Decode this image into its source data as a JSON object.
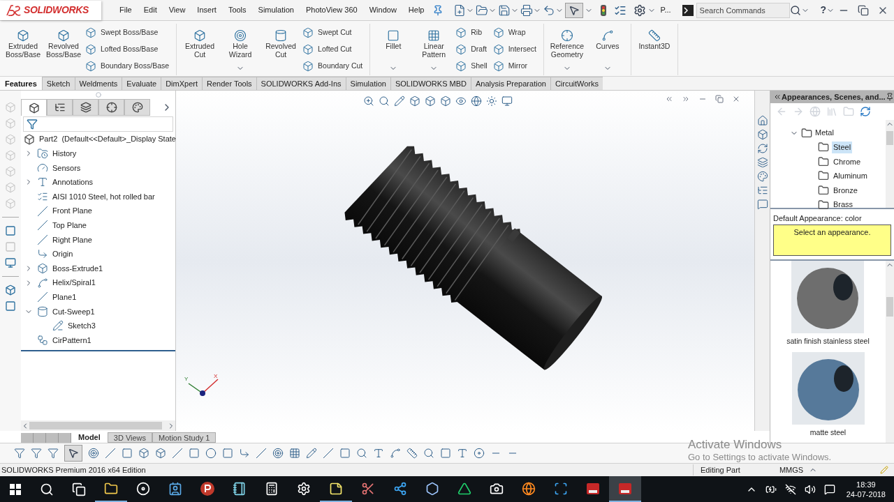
{
  "title_bar": {
    "logo": "SOLIDWORKS",
    "menu": [
      "File",
      "Edit",
      "View",
      "Insert",
      "Tools",
      "Simulation",
      "PhotoView 360",
      "Window",
      "Help"
    ],
    "truncated_command": "P...",
    "search": {
      "placeholder": "Search Commands"
    },
    "help": "?"
  },
  "ribbon": {
    "groups": [
      {
        "columns": [
          {
            "kind": "large",
            "label": "Extruded Boss/Base",
            "dropdown": false
          },
          {
            "kind": "large",
            "label": "Revolved Boss/Base",
            "dropdown": false
          },
          {
            "kind": "stack",
            "items": [
              "Swept Boss/Base",
              "Lofted Boss/Base",
              "Boundary Boss/Base"
            ]
          }
        ]
      },
      {
        "columns": [
          {
            "kind": "large",
            "label": "Extruded Cut",
            "dropdown": false
          },
          {
            "kind": "large",
            "label": "Hole Wizard",
            "dropdown": true
          },
          {
            "kind": "large",
            "label": "Revolved Cut",
            "dropdown": false
          },
          {
            "kind": "stack",
            "items": [
              "Swept Cut",
              "Lofted Cut",
              "Boundary Cut"
            ]
          }
        ]
      },
      {
        "columns": [
          {
            "kind": "large",
            "label": "Fillet",
            "dropdown": true
          },
          {
            "kind": "large",
            "label": "Linear Pattern",
            "dropdown": true
          },
          {
            "kind": "stack",
            "items": [
              "Rib",
              "Draft",
              "Shell"
            ]
          },
          {
            "kind": "stack",
            "items": [
              "Wrap",
              "Intersect",
              "Mirror"
            ]
          }
        ]
      },
      {
        "columns": [
          {
            "kind": "large",
            "label": "Reference Geometry",
            "dropdown": true
          },
          {
            "kind": "large",
            "label": "Curves",
            "dropdown": true
          }
        ]
      },
      {
        "columns": [
          {
            "kind": "large",
            "label": "Instant3D",
            "dropdown": false
          }
        ]
      }
    ]
  },
  "command_tabs": [
    {
      "label": "Features",
      "selected": true
    },
    {
      "label": "Sketch",
      "selected": false
    },
    {
      "label": "Weldments",
      "selected": false
    },
    {
      "label": "Evaluate",
      "selected": false
    },
    {
      "label": "DimXpert",
      "selected": false
    },
    {
      "label": "Render Tools",
      "selected": false
    },
    {
      "label": "SOLIDWORKS Add-Ins",
      "selected": false
    },
    {
      "label": "Simulation",
      "selected": false
    },
    {
      "label": "SOLIDWORKS MBD",
      "selected": false
    },
    {
      "label": "Analysis Preparation",
      "selected": false
    },
    {
      "label": "CircuitWorks",
      "selected": false
    }
  ],
  "feature_manager": {
    "panel_tabs": [
      {
        "selected": true
      },
      {
        "selected": false
      },
      {
        "selected": false
      },
      {
        "selected": false
      },
      {
        "selected": false
      }
    ],
    "root": "Part2  (Default<<Default>_Display State",
    "items": [
      {
        "label": "History",
        "kind": "history",
        "has_children": true,
        "expanded": false
      },
      {
        "label": "Sensors",
        "kind": "sensor",
        "has_children": false
      },
      {
        "label": "Annotations",
        "kind": "annotation",
        "has_children": true,
        "expanded": false
      },
      {
        "label": "AISI 1010 Steel, hot rolled bar",
        "kind": "material",
        "has_children": false
      },
      {
        "label": "Front Plane",
        "kind": "plane",
        "has_children": false
      },
      {
        "label": "Top Plane",
        "kind": "plane",
        "has_children": false
      },
      {
        "label": "Right Plane",
        "kind": "plane",
        "has_children": false
      },
      {
        "label": "Origin",
        "kind": "origin",
        "has_children": false
      },
      {
        "label": "Boss-Extrude1",
        "kind": "extrude",
        "has_children": true,
        "expanded": false
      },
      {
        "label": "Helix/Spiral1",
        "kind": "helix",
        "has_children": true,
        "expanded": false
      },
      {
        "label": "Plane1",
        "kind": "plane",
        "has_children": false
      },
      {
        "label": "Cut-Sweep1",
        "kind": "sweep",
        "has_children": true,
        "expanded": true,
        "children": [
          {
            "label": "Sketch3",
            "kind": "sketch",
            "has_children": false
          }
        ]
      },
      {
        "label": "CirPattern1",
        "kind": "pattern",
        "has_children": false
      }
    ]
  },
  "viewport": {
    "triad_labels": [
      "Y",
      "X"
    ]
  },
  "model_tabs": [
    {
      "label": "Model",
      "selected": true
    },
    {
      "label": "3D Views",
      "selected": false
    },
    {
      "label": "Motion Study 1",
      "selected": false
    }
  ],
  "task_pane": {
    "title": "Appearances, Scenes, and...",
    "tree": {
      "label": "Metal",
      "expanded": true,
      "children": [
        {
          "label": "Steel",
          "selected": true
        },
        {
          "label": "Chrome",
          "selected": false
        },
        {
          "label": "Aluminum",
          "selected": false
        },
        {
          "label": "Bronze",
          "selected": false
        },
        {
          "label": "Brass",
          "selected": false
        }
      ]
    },
    "description": "Default Appearance: color",
    "hint": "Select an appearance.",
    "swatches": [
      {
        "label": "satin finish stainless steel",
        "color": "#6e6e6e"
      },
      {
        "label": "matte steel",
        "color": "#56799a"
      }
    ]
  },
  "windows_notice": {
    "title": "Activate Windows",
    "message": "Go to Settings to activate Windows."
  },
  "status_bar": {
    "edition": "SOLIDWORKS Premium 2016 x64 Edition",
    "mode": "Editing Part",
    "units": "MMGS"
  },
  "taskbar": {
    "apps": [
      {
        "kind": "explorer",
        "running": true,
        "active": false
      },
      {
        "kind": "groove",
        "running": false,
        "active": false
      },
      {
        "kind": "contacts",
        "running": false,
        "active": false
      },
      {
        "kind": "psiphon",
        "running": false,
        "active": false
      },
      {
        "kind": "notepad",
        "running": false,
        "active": false
      },
      {
        "kind": "calculator",
        "running": false,
        "active": false
      },
      {
        "kind": "settings",
        "running": false,
        "active": false
      },
      {
        "kind": "sticky",
        "running": true,
        "active": false
      },
      {
        "kind": "paint",
        "running": false,
        "active": false
      },
      {
        "kind": "share",
        "running": false,
        "active": false
      },
      {
        "kind": "launcher",
        "running": false,
        "active": false
      },
      {
        "kind": "triangle",
        "running": false,
        "active": false
      },
      {
        "kind": "camera",
        "running": false,
        "active": false
      },
      {
        "kind": "firefox",
        "running": false,
        "active": false
      },
      {
        "kind": "capture",
        "running": false,
        "active": false
      },
      {
        "kind": "sw",
        "running": false,
        "active": false
      },
      {
        "kind": "sw",
        "running": true,
        "active": true
      }
    ],
    "time": "18:39",
    "date": "24-07-2018"
  }
}
